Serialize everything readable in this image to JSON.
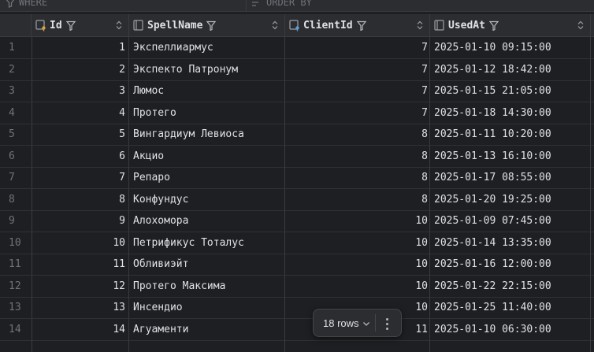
{
  "filter": {
    "where_placeholder": "WHERE",
    "orderby_placeholder": "ORDER BY"
  },
  "columns": [
    {
      "label": "Id"
    },
    {
      "label": "SpellName"
    },
    {
      "label": "ClientId"
    },
    {
      "label": "UsedAt"
    }
  ],
  "rows": [
    {
      "n": "1",
      "id": "1",
      "name": "Экспеллиармус",
      "client": "7",
      "used": "2025-01-10 09:15:00"
    },
    {
      "n": "2",
      "id": "2",
      "name": "Экспекто Патронум",
      "client": "7",
      "used": "2025-01-12 18:42:00"
    },
    {
      "n": "3",
      "id": "3",
      "name": "Люмос",
      "client": "7",
      "used": "2025-01-15 21:05:00"
    },
    {
      "n": "4",
      "id": "4",
      "name": "Протего",
      "client": "7",
      "used": "2025-01-18 14:30:00"
    },
    {
      "n": "5",
      "id": "5",
      "name": "Вингардиум Левиоса",
      "client": "8",
      "used": "2025-01-11 10:20:00"
    },
    {
      "n": "6",
      "id": "6",
      "name": "Акцио",
      "client": "8",
      "used": "2025-01-13 16:10:00"
    },
    {
      "n": "7",
      "id": "7",
      "name": "Репаро",
      "client": "8",
      "used": "2025-01-17 08:55:00"
    },
    {
      "n": "8",
      "id": "8",
      "name": "Конфундус",
      "client": "8",
      "used": "2025-01-20 19:25:00"
    },
    {
      "n": "9",
      "id": "9",
      "name": "Алохомора",
      "client": "10",
      "used": "2025-01-09 07:45:00"
    },
    {
      "n": "10",
      "id": "10",
      "name": "Петрификус Тоталус",
      "client": "10",
      "used": "2025-01-14 13:35:00"
    },
    {
      "n": "11",
      "id": "11",
      "name": "Обливиэйт",
      "client": "10",
      "used": "2025-01-16 12:00:00"
    },
    {
      "n": "12",
      "id": "12",
      "name": "Протего Максима",
      "client": "10",
      "used": "2025-01-22 22:15:00"
    },
    {
      "n": "13",
      "id": "13",
      "name": "Инсендио",
      "client": "10",
      "used": "2025-01-25 11:40:00"
    },
    {
      "n": "14",
      "id": "14",
      "name": "Агуаменти",
      "client": "11",
      "used": "2025-01-10 06:30:00"
    }
  ],
  "status": {
    "row_count": "18 rows"
  }
}
